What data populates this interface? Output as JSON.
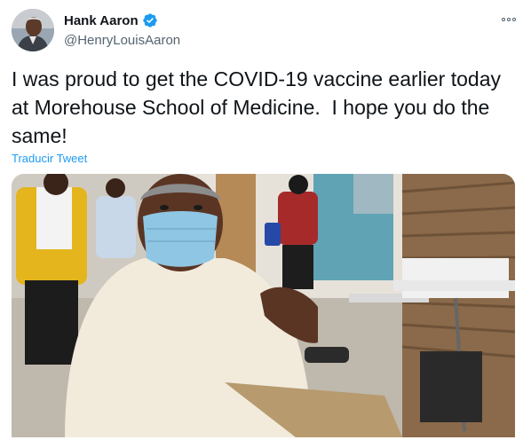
{
  "author": {
    "display_name": "Hank Aaron",
    "handle": "@HenryLouisAaron",
    "verified": true
  },
  "tweet": {
    "text": "I was proud to get the COVID-19 vaccine earlier today\nat Morehouse School of Medicine.  I hope you do the\nsame!",
    "translate_label": "Traducir Tweet"
  },
  "icons": {
    "verified": "verified-badge-icon",
    "more": "more-options-icon"
  },
  "colors": {
    "link": "#1d9bf0",
    "secondary_text": "#536471"
  }
}
